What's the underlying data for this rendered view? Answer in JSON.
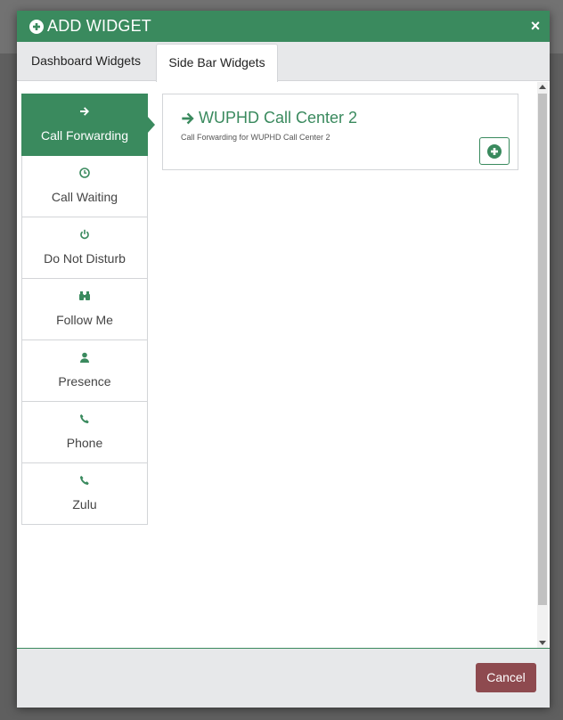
{
  "modal": {
    "title": "ADD WIDGET",
    "close_label": "×",
    "accent_color": "#3a8a5e",
    "danger_color": "#8e4a4f"
  },
  "tabs": [
    {
      "label": "Dashboard Widgets",
      "active": false
    },
    {
      "label": "Side Bar Widgets",
      "active": true
    }
  ],
  "sidebar": {
    "items": [
      {
        "label": "Call Forwarding",
        "icon": "arrow-right-icon",
        "active": true
      },
      {
        "label": "Call Waiting",
        "icon": "clock-icon",
        "active": false
      },
      {
        "label": "Do Not Disturb",
        "icon": "power-icon",
        "active": false
      },
      {
        "label": "Follow Me",
        "icon": "binoculars-icon",
        "active": false
      },
      {
        "label": "Presence",
        "icon": "user-icon",
        "active": false
      },
      {
        "label": "Phone",
        "icon": "phone-icon",
        "active": false
      },
      {
        "label": "Zulu",
        "icon": "phone-icon",
        "active": false
      }
    ]
  },
  "widget": {
    "title": "WUPHD Call Center 2",
    "description": "Call Forwarding for WUPHD Call Center 2",
    "icon": "arrow-right-icon",
    "add_icon": "plus-circle-icon"
  },
  "footer": {
    "cancel_label": "Cancel"
  }
}
